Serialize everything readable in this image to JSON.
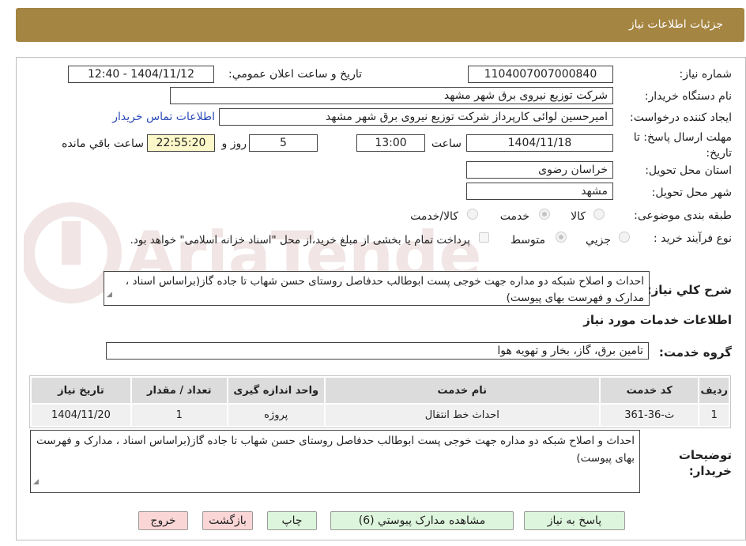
{
  "header": {
    "title": "جزئيات اطلاعات نياز"
  },
  "form": {
    "need_number": {
      "label": "شماره نياز:",
      "value": "1104007007000840"
    },
    "announce_datetime": {
      "label": "تاريخ و ساعت اعلان عمومي:",
      "value": "1404/11/12 - 12:40"
    },
    "buyer_org": {
      "label": "نام دستگاه خريدار:",
      "value": "شرکت توزیع نیروی برق شهر مشهد"
    },
    "requester": {
      "label": "ايجاد کننده درخواست:",
      "value": "امیرحسین  لوائی کارپرداز شرکت توزیع نیروی برق شهر مشهد",
      "contact_link": "اطلاعات تماس خريدار"
    },
    "deadline": {
      "label": "مهلت ارسال پاسخ: تا تاريخ:",
      "date": "1404/11/18",
      "time_label": "ساعت",
      "time": "13:00",
      "days": "5",
      "days_label": "روز و",
      "remaining": "22:55:20",
      "remaining_label": "ساعت باقي مانده"
    },
    "province": {
      "label": "استان محل تحويل:",
      "value": "خراسان رضوی"
    },
    "city": {
      "label": "شهر محل تحويل:",
      "value": "مشهد"
    },
    "category": {
      "label": "طبقه بندی موضوعی:",
      "options": [
        "کالا",
        "خدمت",
        "کالا/خدمت"
      ],
      "selected": "خدمت"
    },
    "process": {
      "label": "نوع فرآيند خريد :",
      "options": [
        "جزيي",
        "متوسط"
      ],
      "selected": "متوسط",
      "note": "پرداخت تمام یا بخشی از مبلغ خرید،از محل \"اسناد خزانه اسلامی\" خواهد بود."
    },
    "summary": {
      "label": "شرح کلي نياز:",
      "value": "احداث و اصلاح شبکه دو مداره جهت خوجی پست ابوطالب حدفاصل روستای حسن شهاب تا جاده گاز(براساس اسناد ، مدارک و فهرست بهای پیوست)"
    }
  },
  "services": {
    "section_title": "اطلاعات خدمات مورد نياز",
    "group_label": "گروه خدمت:",
    "group_value": "تامین برق، گاز، بخار و تهویه هوا",
    "columns": [
      "رديف",
      "کد خدمت",
      "نام خدمت",
      "واحد اندازه گيری",
      "تعداد / مقدار",
      "تاريخ نياز"
    ],
    "rows": [
      [
        "1",
        "ث-36-361",
        "احداث خط انتقال",
        "پروژه",
        "1",
        "1404/11/20"
      ]
    ]
  },
  "buyer_notes": {
    "label": "توضيحات خريدار:",
    "value": "احداث و اصلاح شبکه دو مداره جهت خوجی پست ابوطالب حدفاصل روستای حسن شهاب تا جاده گاز(براساس اسناد ، مدارک و فهرست بهای پیوست)"
  },
  "buttons": {
    "reply": "پاسخ به نياز",
    "attachments": "مشاهده مدارک پيوستي (6)",
    "print": "چاپ",
    "back": "بازگشت",
    "exit": "خروج"
  },
  "watermark": {
    "text": "AriaTender.neT",
    "color": "#8b1a1a"
  },
  "colors": {
    "header": "#a58542",
    "link": "#2a49b5",
    "highlight": "#fdf8c9",
    "btn_green": "#ddf5dc",
    "btn_pink": "#fbd6d6"
  }
}
